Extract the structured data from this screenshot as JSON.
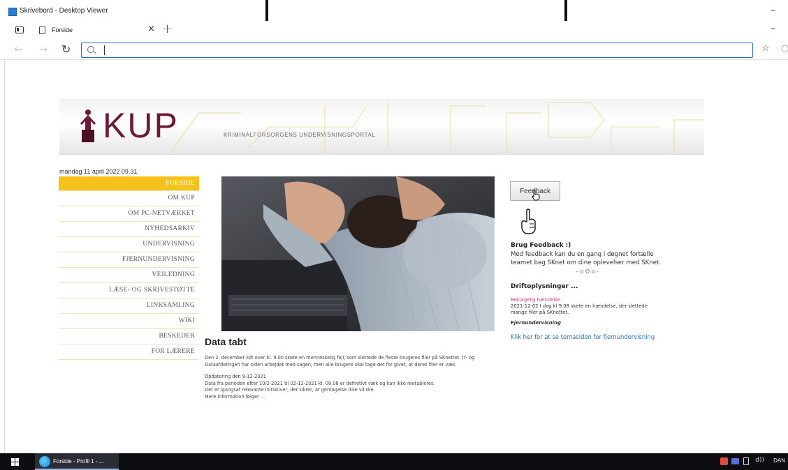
{
  "window": {
    "title": "Skrivebord - Desktop Viewer",
    "minimize_glyph": "–"
  },
  "viewer_toolbar": {
    "label": "...... · ......"
  },
  "browser": {
    "tab": {
      "label": "Forside",
      "close_glyph": "×"
    },
    "new_tab_glyph": "+",
    "url_value": "",
    "icons": [
      "tab-actions-icon",
      "page-icon",
      "back-arrow-icon",
      "forward-arrow-icon",
      "refresh-icon",
      "search-icon",
      "favorites-icon"
    ]
  },
  "site": {
    "logo_text": "KUP",
    "logo_subtitle": "KRIMINALFORSORGENS UNDERVISNINGSPORTAL",
    "brand_color": "#6d1a34",
    "accent_color": "#f4c21a",
    "datetime": "mandag 11 april 2022 09.31"
  },
  "nav": {
    "items": [
      {
        "label": "FORSIDE",
        "active": true
      },
      {
        "label": "OM KUP"
      },
      {
        "label": "OM PC-NETVÆRKET"
      },
      {
        "label": "NYHEDSARKIV"
      },
      {
        "label": "UNDERVISNING"
      },
      {
        "label": "FJERNUNDERVISNING"
      },
      {
        "label": "VEJLEDNING"
      },
      {
        "label": "LÆSE- OG SKRIVESTØTTE"
      },
      {
        "label": "LINKSAMLING"
      },
      {
        "label": "WIKI"
      },
      {
        "label": "BESKEDER"
      },
      {
        "label": "FOR LÆRERE"
      }
    ]
  },
  "article": {
    "title": "Data tabt",
    "paragraph1": "Den 2. december lidt over kl. 9.00 skete en menneskelig fejl, som slettede de fleste brugeres filer på SKnettet. IT- og Dataafdelingen har siden arbejdet med sagen, men alle brugere skal tage det for givet, at deres filer er væk.",
    "update_heading": "Opdatering den 9-12-2021",
    "update_line1": "Data fra perioden efter 10/2-2021 til 02-12-2021 kl. 09.08 er definitivt væk og kan ikke reetableres.",
    "update_line2": "Der er igangsat relevante initiativer, der sikrer, at gentagelse ikke vil ske.",
    "update_line3": "Mere information følger ..."
  },
  "sidebar": {
    "feedback_button": "Feedback",
    "feedback_title": "Brug Feedback :)",
    "feedback_text": "Med feedback kan du en gang i døgnet fortælle teamet bag SKnet om dine oplevelser med SKnet.",
    "divider": "- o O o -",
    "drift_title": "Driftoplysninger ...",
    "drift_item_title": "Beklagelig hændelse",
    "drift_item_text": "2021-12-02 I dag kl 9.08 skete en hændelse, der slettede mange filer på SKnettet.",
    "fj_title": "Fjernundervisning",
    "fj_link": "Klik her for at se temasiden for fjernundervisning",
    "link_color": "#2b6db3"
  },
  "taskbar": {
    "app_label": "Forside - Profil 1 - ...",
    "language": "DAN",
    "volume_glyph": "d))"
  }
}
